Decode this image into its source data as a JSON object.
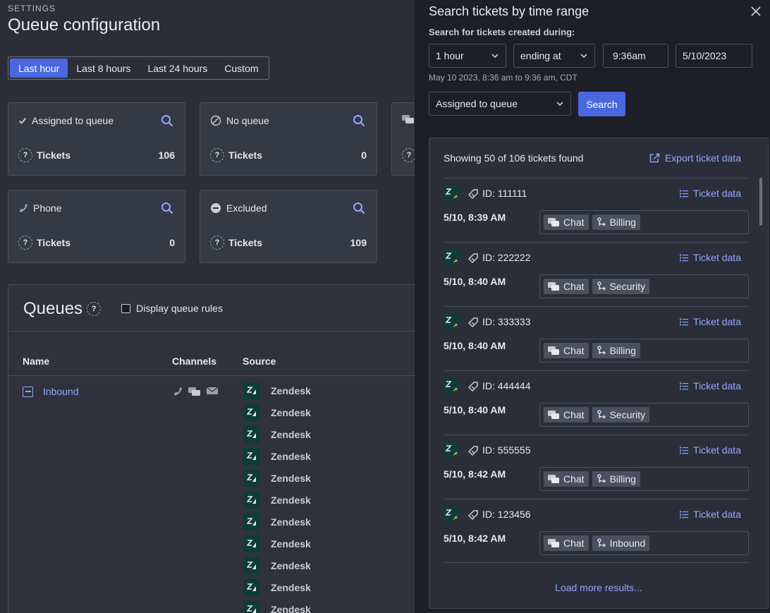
{
  "header": {
    "eyebrow": "SETTINGS",
    "title": "Queue configuration"
  },
  "time_filter": {
    "options": [
      "Last hour",
      "Last 8 hours",
      "Last 24 hours",
      "Custom"
    ],
    "selected": "Last hour"
  },
  "cards": [
    {
      "label": "Assigned to queue",
      "icon": "check-icon",
      "metric": "Tickets",
      "value": "106"
    },
    {
      "label": "No queue",
      "icon": "no-queue-icon",
      "metric": "Tickets",
      "value": "0"
    },
    {
      "label": "Phone",
      "icon": "phone-icon",
      "metric": "Tickets",
      "value": "0"
    },
    {
      "label": "Excluded",
      "icon": "excluded-icon",
      "metric": "Tickets",
      "value": "109"
    }
  ],
  "queues": {
    "title": "Queues",
    "display_rules_label": "Display queue rules",
    "columns": [
      "Name",
      "Channels",
      "Source"
    ],
    "rows": [
      {
        "name": "Inbound",
        "channels": [
          "phone-icon",
          "chat-icon",
          "mail-icon"
        ],
        "sources": [
          "Zendesk",
          "Zendesk",
          "Zendesk",
          "Zendesk",
          "Zendesk",
          "Zendesk",
          "Zendesk",
          "Zendesk",
          "Zendesk",
          "Zendesk",
          "Zendesk"
        ]
      }
    ]
  },
  "panel": {
    "title": "Search tickets by time range",
    "created_label": "Search for tickets created during:",
    "duration": "1 hour",
    "anchor": "ending at",
    "time": "9:36am",
    "date": "5/10/2023",
    "range_text": "May 10 2023, 8:36 am to 9:36 am, CDT",
    "queue_filter": "Assigned to queue",
    "search_label": "Search",
    "results_count": "Showing 50 of 106 tickets found",
    "export_label": "Export ticket data",
    "ticket_data_label": "Ticket data",
    "load_more": "Load more results...",
    "tickets": [
      {
        "id": "ID: 111111",
        "date": "5/10, 8:39 AM",
        "channel": "Chat",
        "queue": "Billing"
      },
      {
        "id": "ID: 222222",
        "date": "5/10, 8:40 AM",
        "channel": "Chat",
        "queue": "Security"
      },
      {
        "id": "ID: 333333",
        "date": "5/10, 8:40 AM",
        "channel": "Chat",
        "queue": "Billing"
      },
      {
        "id": "ID: 444444",
        "date": "5/10, 8:40 AM",
        "channel": "Chat",
        "queue": "Security"
      },
      {
        "id": "ID: 555555",
        "date": "5/10, 8:42 AM",
        "channel": "Chat",
        "queue": "Billing"
      },
      {
        "id": "ID: 123456",
        "date": "5/10, 8:42 AM",
        "channel": "Chat",
        "queue": "Inbound"
      }
    ]
  },
  "colors": {
    "accent": "#4a67e0",
    "link": "#8ea8ff",
    "background": "#2b2e38",
    "panel": "#1d1f26"
  }
}
